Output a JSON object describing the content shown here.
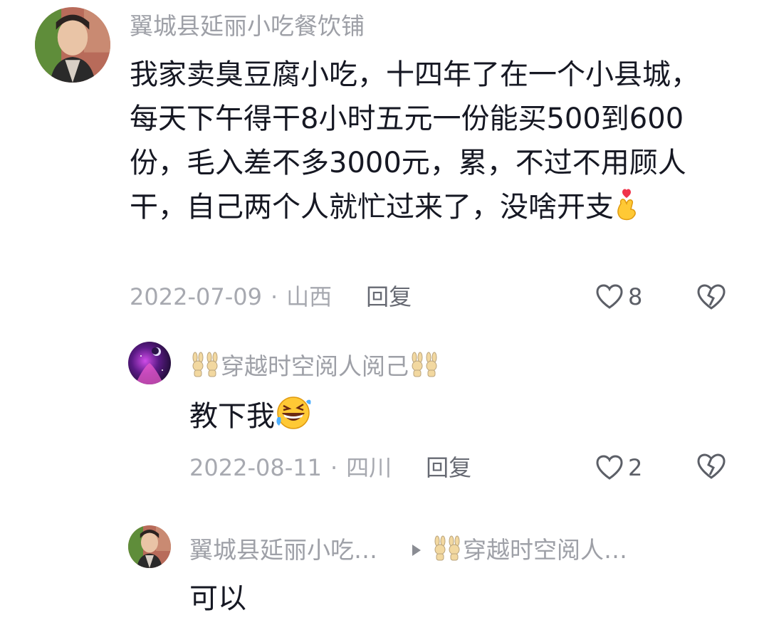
{
  "comments": [
    {
      "author": "翼城县延丽小吃餐饮铺",
      "text": "我家卖臭豆腐小吃，十四年了在一个小县城，每天下午得干8小时五元一份能买500到600份，毛入差不多3000元，累，不过不用顾人干，自己两个人就忙过来了，没啥开支",
      "emoji": "crossed-fingers-heart-emoji",
      "date": "2022-07-09",
      "sep": "·",
      "location": "山西",
      "reply_label": "回复",
      "likes": "8"
    },
    {
      "author": "穿越时空阅人阅己",
      "text": "教下我",
      "emoji": "rolling-laughing-emoji",
      "date": "2022-08-11",
      "sep": "·",
      "location": "四川",
      "reply_label": "回复",
      "likes": "2"
    },
    {
      "author": "翼城县延丽小吃…",
      "reply_to": "穿越时空阅人…",
      "text": "可以"
    }
  ]
}
